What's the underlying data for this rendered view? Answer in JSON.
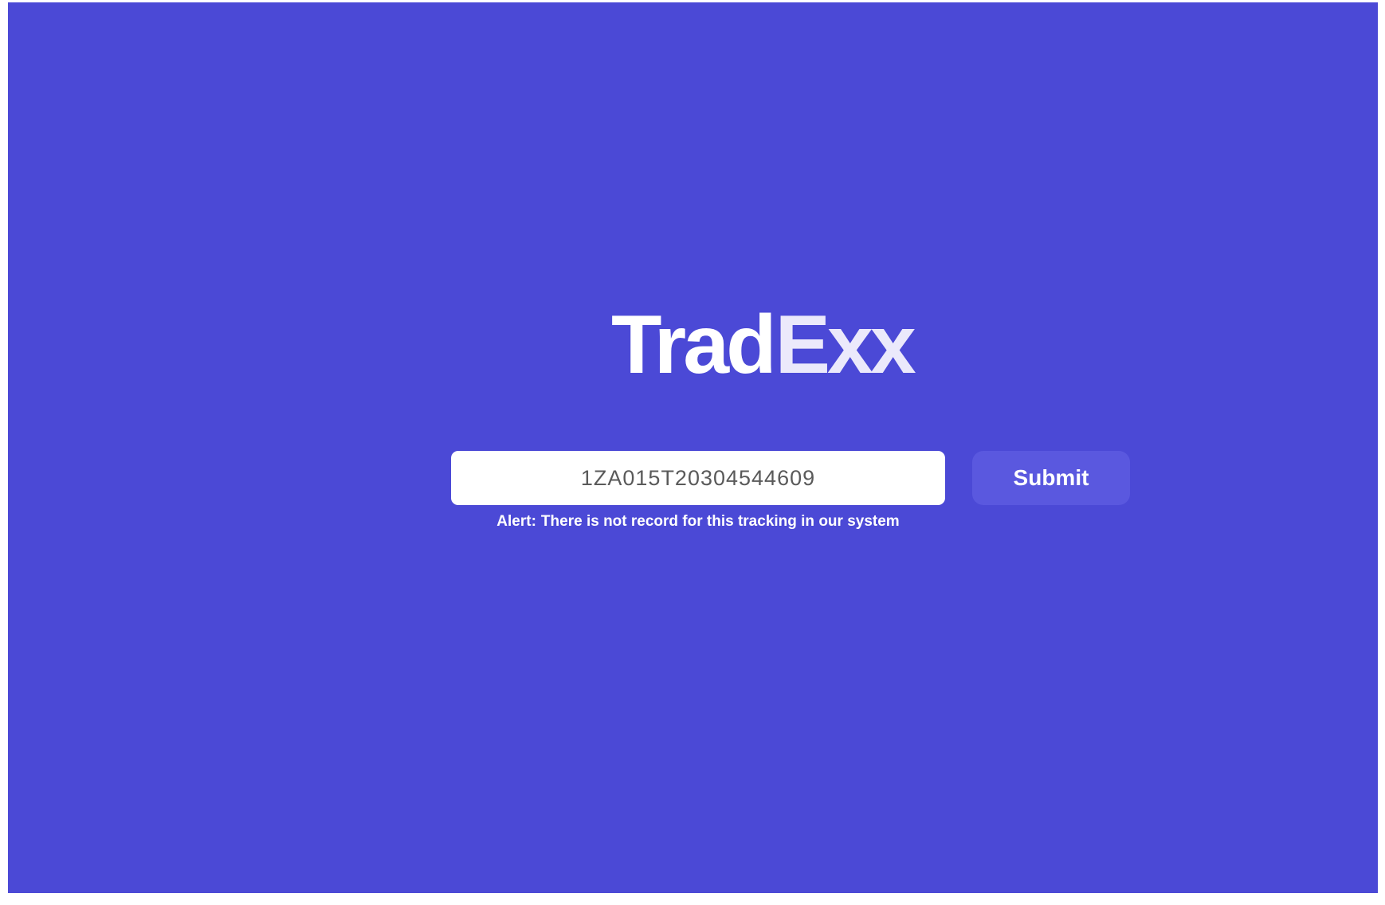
{
  "brand": {
    "logo_left": "Trad",
    "logo_right": "Exx"
  },
  "tracking": {
    "value": "1ZA015T20304544609"
  },
  "submit": {
    "label": "Submit"
  },
  "alert": {
    "prefix": "Alert:",
    "message": "There is not record for this tracking in our system"
  },
  "colors": {
    "background": "#4b49d6",
    "button": "#5a58df",
    "input": "#ffffff",
    "text": "#ffffff"
  }
}
